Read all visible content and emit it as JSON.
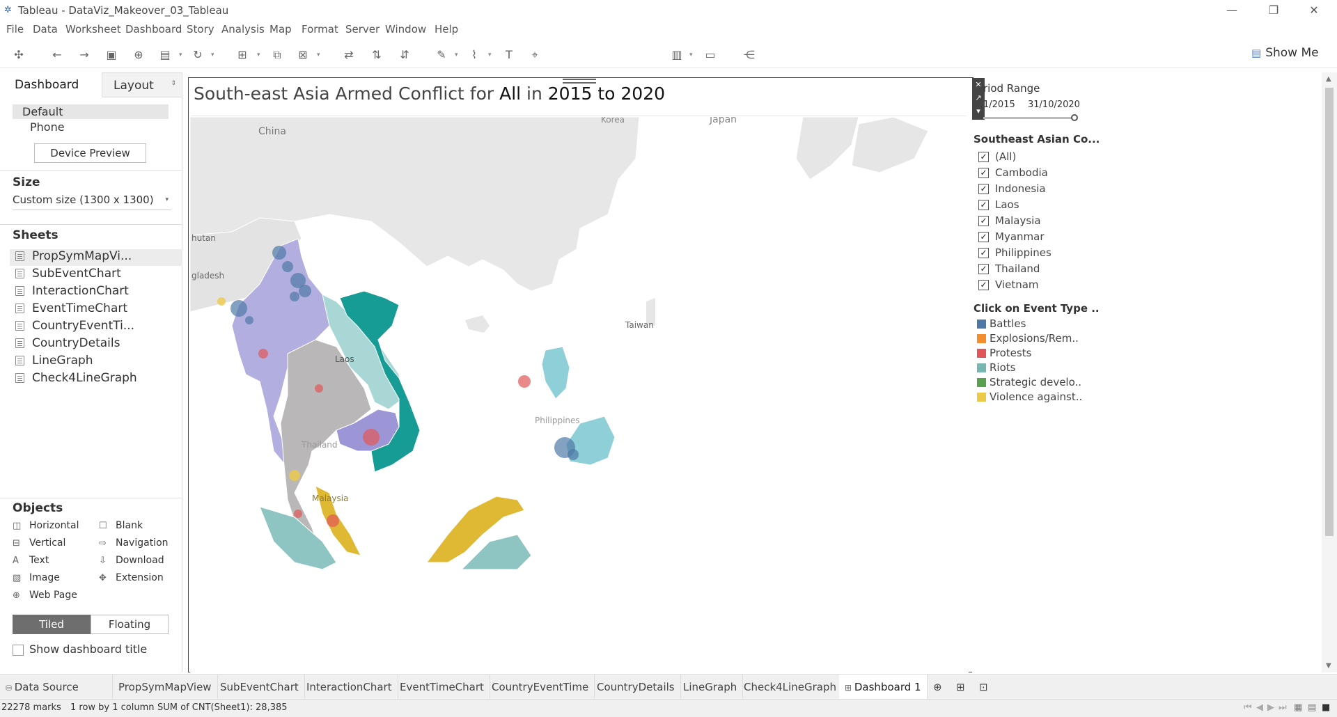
{
  "window": {
    "title": "Tableau - DataViz_Makeover_03_Tableau"
  },
  "menu": [
    "File",
    "Data",
    "Worksheet",
    "Dashboard",
    "Story",
    "Analysis",
    "Map",
    "Format",
    "Server",
    "Window",
    "Help"
  ],
  "toolbar": {
    "show_me_label": "Show Me"
  },
  "left_pane": {
    "tab_dashboard": "Dashboard",
    "tab_layout": "Layout",
    "device_default": "Default",
    "device_phone": "Phone",
    "device_preview_button": "Device Preview",
    "size_title": "Size",
    "size_value": "Custom size (1300 x 1300)",
    "sheets_title": "Sheets",
    "sheets": [
      "PropSymMapVi...",
      "SubEventChart",
      "InteractionChart",
      "EventTimeChart",
      "CountryEventTi...",
      "CountryDetails",
      "LineGraph",
      "Check4LineGraph"
    ],
    "objects_title": "Objects",
    "objects": {
      "horizontal": "Horizontal",
      "blank": "Blank",
      "vertical": "Vertical",
      "navigation": "Navigation",
      "text": "Text",
      "download": "Download",
      "image": "Image",
      "extension": "Extension",
      "webpage": "Web Page"
    },
    "tiled": "Tiled",
    "floating": "Floating",
    "show_dashboard_title": "Show dashboard title"
  },
  "dashboard": {
    "title_prefix": "South-east Asia Armed Conflict for ",
    "title_all": "All",
    "title_in": " in ",
    "title_range": "2015 to 2020",
    "map_labels": {
      "china": "China",
      "korea": "Korea",
      "japan": "Japan",
      "bhutan": "hutan",
      "bangladesh": "gladesh",
      "taiwan": "Taiwan",
      "laos": "Laos",
      "thailand": "Thailand",
      "philippines": "Philippines",
      "malaysia": "Malaysia"
    }
  },
  "filters": {
    "period_title": "riod Range",
    "period_start": "1/2015",
    "period_end": "31/10/2020",
    "country_title": "Southeast Asian Co...",
    "countries": [
      "(All)",
      "Cambodia",
      "Indonesia",
      "Laos",
      "Malaysia",
      "Myanmar",
      "Philippines",
      "Thailand",
      "Vietnam"
    ],
    "event_title": "Click on Event Type ..",
    "event_types": [
      {
        "label": "Battles",
        "color": "#4e79a7"
      },
      {
        "label": "Explosions/Rem..",
        "color": "#f28e2b"
      },
      {
        "label": "Protests",
        "color": "#e15759"
      },
      {
        "label": "Riots",
        "color": "#76b7b2"
      },
      {
        "label": "Strategic develo..",
        "color": "#59a14f"
      },
      {
        "label": "Violence against..",
        "color": "#edc948"
      }
    ]
  },
  "sheet_tabs": [
    "Data Source",
    "PropSymMapView",
    "SubEventChart",
    "InteractionChart",
    "EventTimeChart",
    "CountryEventTime",
    "CountryDetails",
    "LineGraph",
    "Check4LineGraph",
    "Dashboard 1"
  ],
  "status": {
    "marks": "22278 marks",
    "rows": "1 row by 1 column",
    "sum": "SUM of CNT(Sheet1): 28,385"
  },
  "colors": {
    "myanmar": "#b3aee0",
    "thailand": "#b9b7b7",
    "laos": "#a9d7d6",
    "vietnam": "#169c95",
    "cambodia": "#9d96d6",
    "malaysia": "#e0b934",
    "indonesia": "#8ec4c2",
    "land_other": "#e6e6e6"
  }
}
